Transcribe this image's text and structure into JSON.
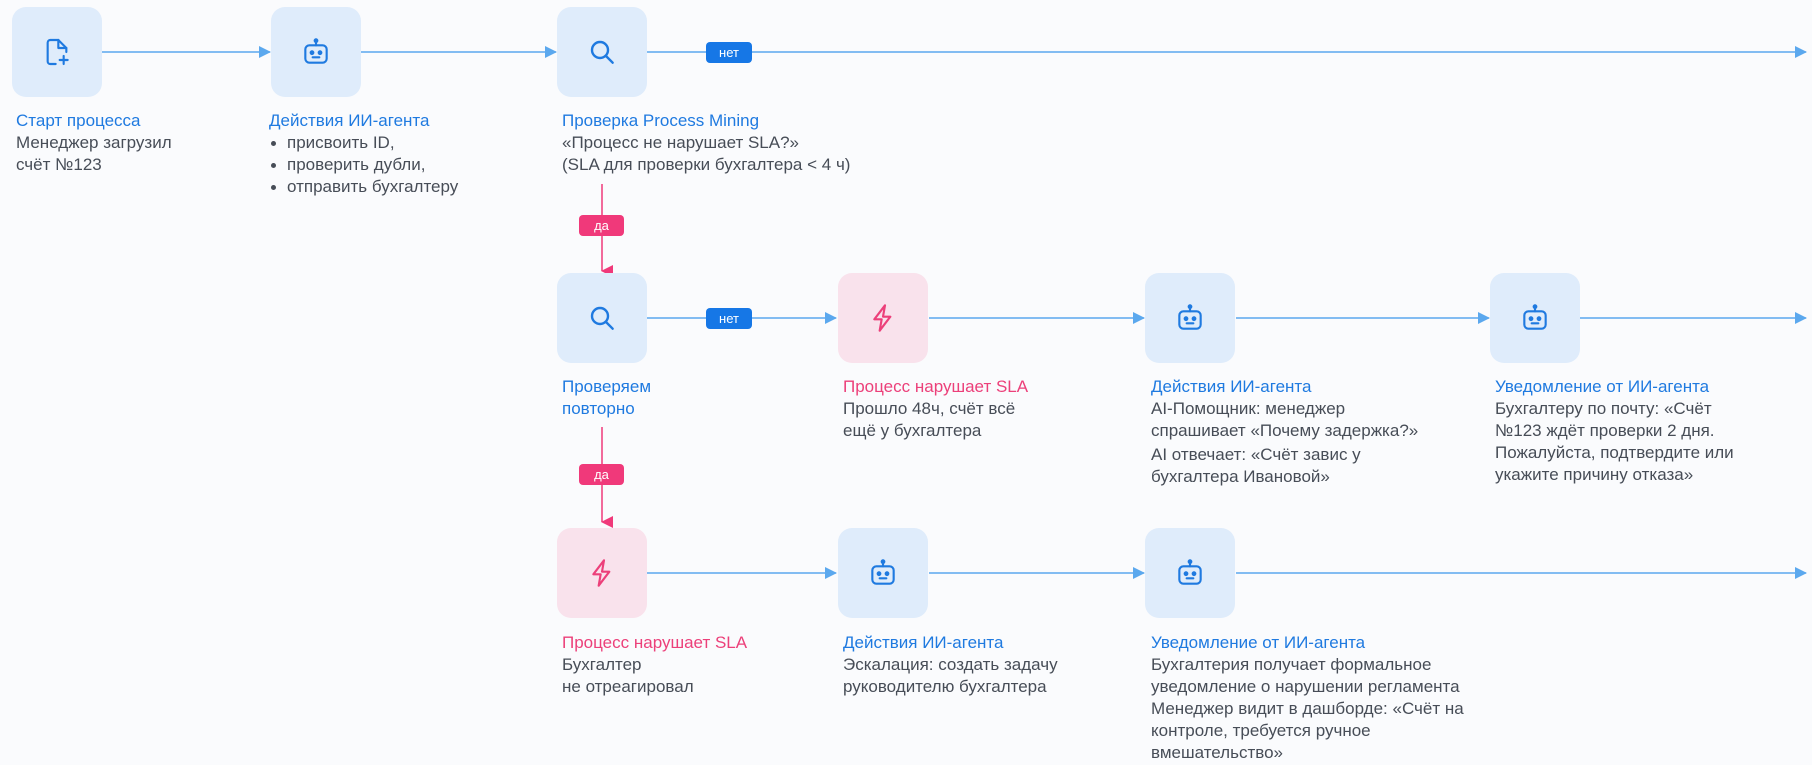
{
  "colors": {
    "accent_blue": "#1f7ae0",
    "accent_pink": "#ec407a",
    "wire_blue": "#5ba8ee",
    "wire_pink": "#f0397a",
    "node_blue_bg": "#dfecfb",
    "node_pink_bg": "#f9e2ec",
    "body_text": "#474d57"
  },
  "badges": {
    "no": "нет",
    "yes": "да"
  },
  "row1": {
    "start": {
      "icon": "file-plus-icon",
      "title": "Старт процесса",
      "lines": [
        "Менеджер загрузил",
        "счёт №123"
      ]
    },
    "agent": {
      "icon": "robot-icon",
      "title": "Действия ИИ-агента",
      "bullets": [
        "присвоить ID,",
        "проверить дубли,",
        "отправить бухгалтеру"
      ]
    },
    "check": {
      "icon": "search-icon",
      "title": "Проверка Process Mining",
      "lines": [
        "«Процесс не нарушает SLA?»",
        "(SLA для проверки бухгалтера < 4 ч)"
      ]
    }
  },
  "row2": {
    "recheck": {
      "icon": "search-icon",
      "title_lines": [
        "Проверяем",
        "повторно"
      ]
    },
    "violation": {
      "icon": "lightning-icon",
      "title": "Процесс нарушает SLA",
      "lines": [
        "Прошло 48ч, счёт всё",
        "ещё у бухгалтера"
      ]
    },
    "agent": {
      "icon": "robot-icon",
      "title": "Действия ИИ-агента",
      "lines": [
        "AI-Помощник: менеджер",
        "спрашивает «Почему задержка?»",
        "AI отвечает: «Счёт завис у",
        "бухгалтера Ивановой»"
      ]
    },
    "notify": {
      "icon": "robot-icon",
      "title": "Уведомление от ИИ-агента",
      "lines": [
        "Бухгалтеру по почту:  «Счёт",
        "№123 ждёт проверки 2 дня.",
        "Пожалуйста, подтвердите или",
        "укажите причину отказа»"
      ]
    }
  },
  "row3": {
    "violation": {
      "icon": "lightning-icon",
      "title": "Процесс нарушает SLA",
      "lines": [
        "Бухгалтер",
        "не отреагировал"
      ]
    },
    "agent": {
      "icon": "robot-icon",
      "title": "Действия ИИ-агента",
      "lines": [
        "Эскалация: создать задачу",
        "руководителю бухгалтера"
      ]
    },
    "notify": {
      "icon": "robot-icon",
      "title": "Уведомление от ИИ-агента",
      "lines": [
        "Бухгалтерия получает формальное",
        "уведомление о нарушении регламента",
        "Менеджер видит в дашборде: «Счёт на",
        "контроле, требуется ручное",
        "вмешательство»"
      ]
    }
  }
}
